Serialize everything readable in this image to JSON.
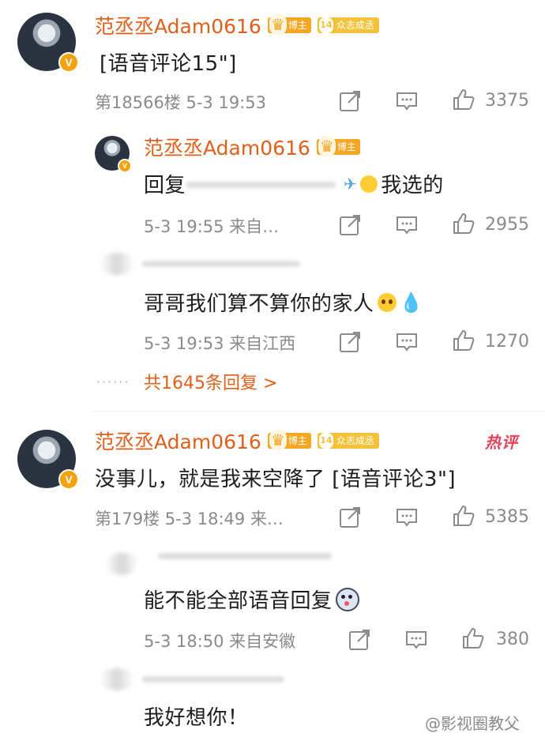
{
  "comment1": {
    "name": "范丞丞Adam0616",
    "badge_blogger": "博主",
    "badge_fan_level": "14",
    "badge_fan": "众志成丞",
    "content": "[语音评论15\"]",
    "meta": "第18566楼 5-3 19:53",
    "likes": "3375",
    "replies": [
      {
        "name": "范丞丞Adam0616",
        "badge_blogger": "博主",
        "content_prefix": "回复",
        "content_suffix": "我选的",
        "meta": "5-3 19:55 来自…",
        "likes": "2955"
      },
      {
        "content": "哥哥我们算不算你的家人",
        "meta": "5-3 19:53 来自江西",
        "likes": "1270"
      }
    ],
    "more_replies": "共1645条回复 >"
  },
  "comment2": {
    "name": "范丞丞Adam0616",
    "badge_blogger": "博主",
    "badge_fan_level": "14",
    "badge_fan": "众志成丞",
    "hot_label": "热评",
    "content": "没事儿，就是我来空降了 [语音评论3\"]",
    "meta": "第179楼 5-3 18:49 来…",
    "likes": "5385",
    "replies": [
      {
        "content": "能不能全部语音回复",
        "meta": "5-3 18:50 来自安徽",
        "likes": "380"
      },
      {
        "content": "我好想你！"
      }
    ]
  },
  "watermark": "@影视圈教父",
  "colors": {
    "name": "#e0601b",
    "badge_orange": "#f6a623",
    "badge_yellow": "#f4c238",
    "meta_gray": "#8a8a8a",
    "hot_red": "#e8425b"
  }
}
